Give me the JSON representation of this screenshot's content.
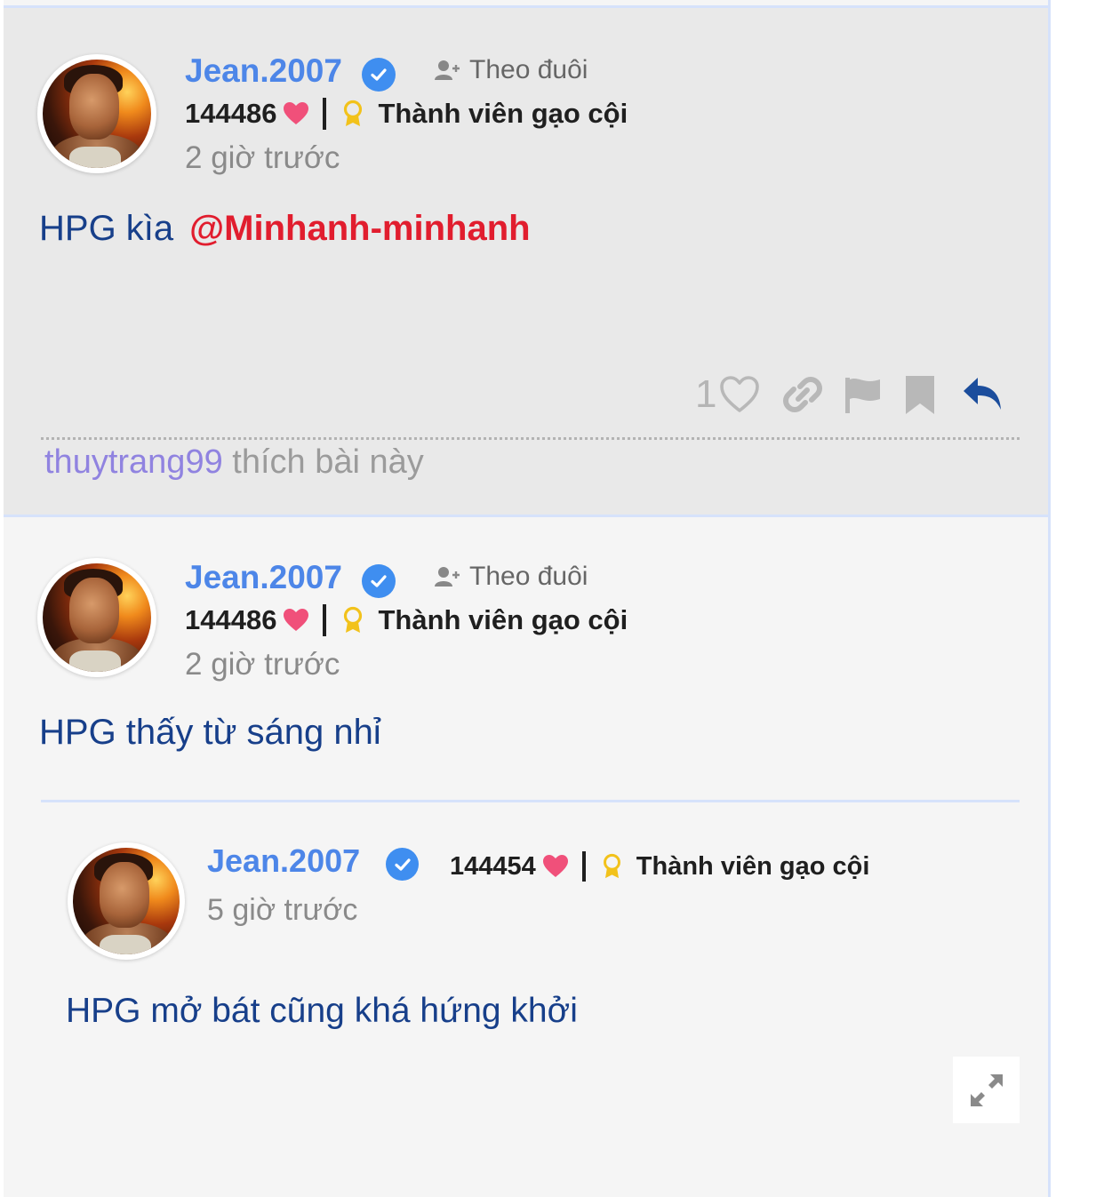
{
  "posts": [
    {
      "username": "Jean.2007",
      "follow_label": "Theo đuôi",
      "points": "144486",
      "rank": "Thành viên gạo cội",
      "time": "2 giờ trước",
      "content": "HPG kìa",
      "mention": "@Minhanh-minhanh",
      "like_count": "1",
      "liker": "thuytrang99",
      "liked_text": "thích bài này"
    },
    {
      "username": "Jean.2007",
      "follow_label": "Theo đuôi",
      "points": "144486",
      "rank": "Thành viên gạo cội",
      "time": "2 giờ trước",
      "content": "HPG thấy từ sáng nhỉ"
    }
  ],
  "quoted": {
    "username": "Jean.2007",
    "points": "144454",
    "rank": "Thành viên gạo cội",
    "time": "5 giờ trước",
    "content": "HPG mở bát cũng khá hứng khởi"
  },
  "icons": {
    "verified": "verified-check-icon",
    "follow": "user-plus-icon",
    "heart": "heart-icon",
    "medal": "medal-icon",
    "link": "link-icon",
    "flag": "flag-icon",
    "bookmark": "bookmark-icon",
    "reply": "reply-icon",
    "expand": "expand-icon"
  },
  "colors": {
    "username": "#4d86e8",
    "mention": "#e11d2e",
    "content": "#173f8a",
    "liker": "#9083e0",
    "heart": "#f0507a",
    "medal": "#f2c21b"
  }
}
